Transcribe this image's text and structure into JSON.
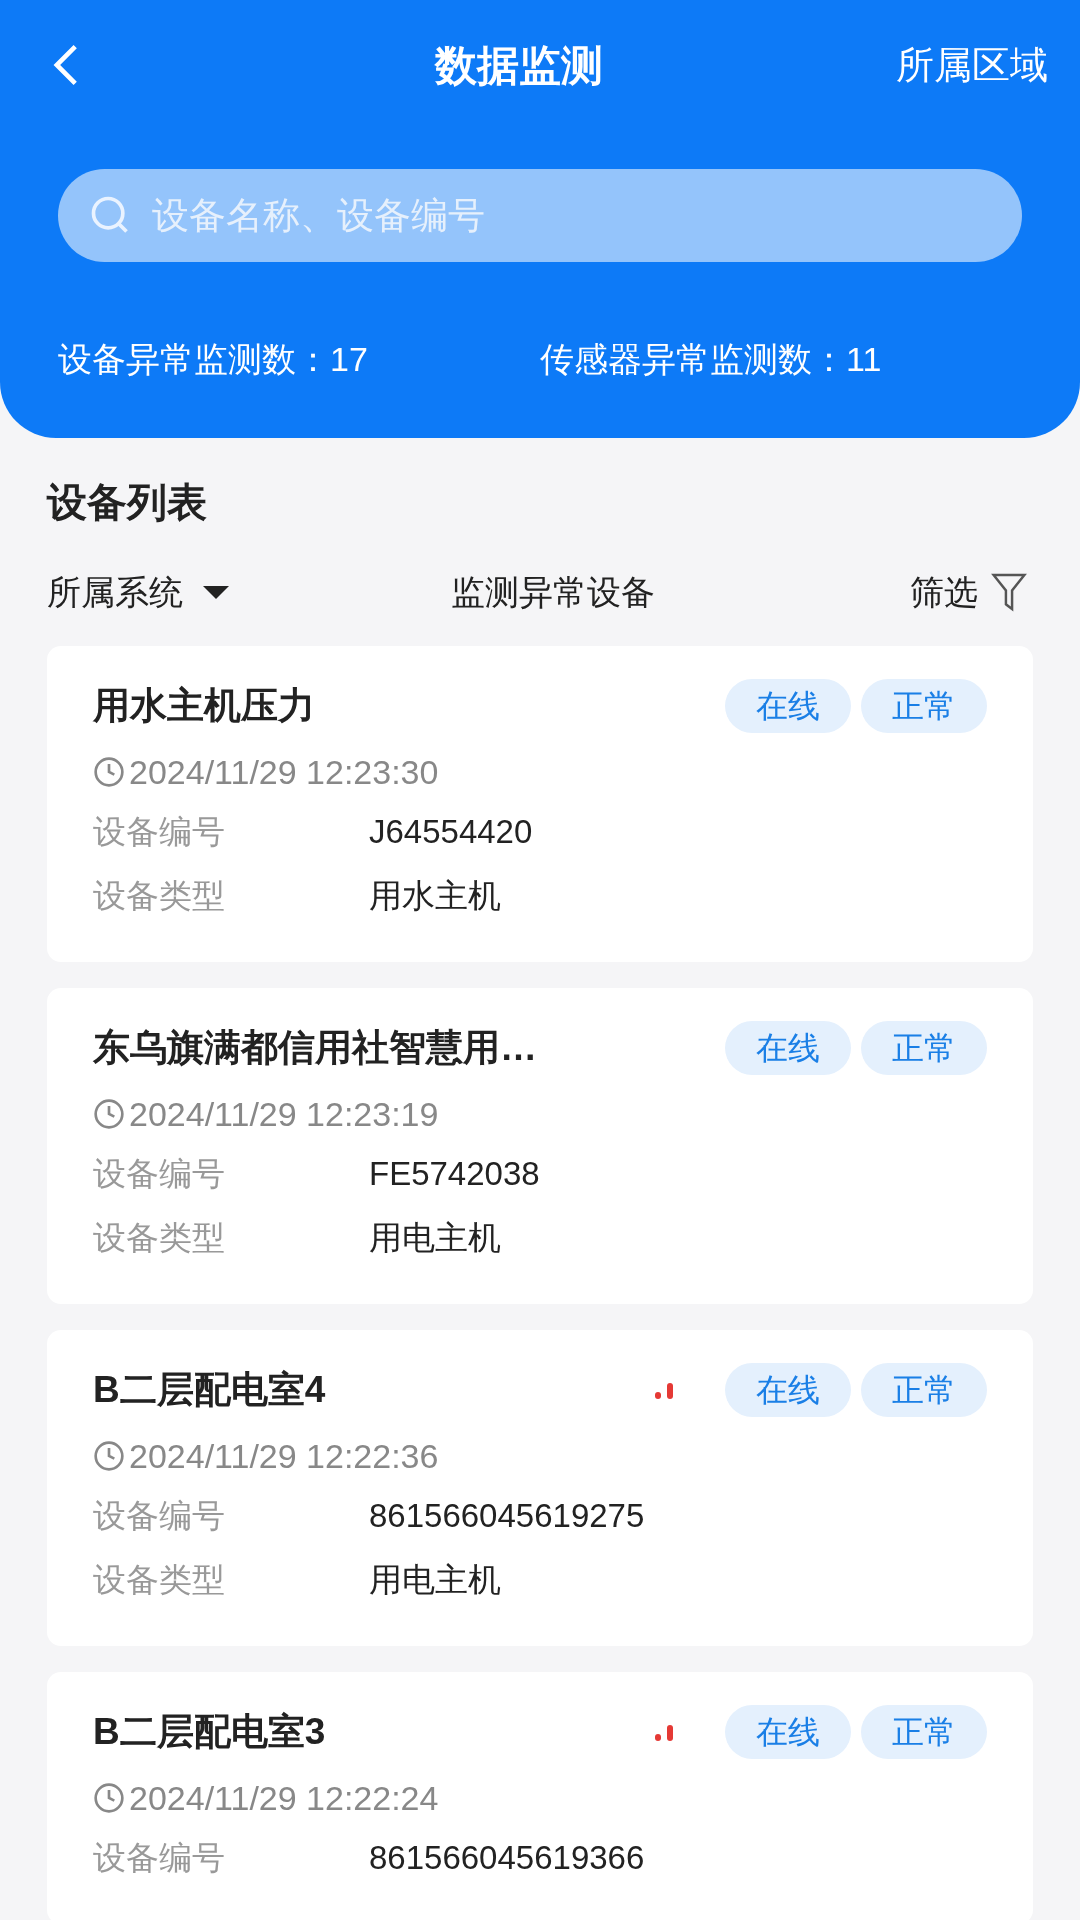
{
  "header": {
    "title": "数据监测",
    "right_action": "所属区域"
  },
  "search": {
    "placeholder": "设备名称、设备编号"
  },
  "stats": [
    {
      "label": "设备异常监测数：",
      "value": "17"
    },
    {
      "label": "传感器异常监测数：",
      "value": "11"
    }
  ],
  "section_title": "设备列表",
  "filters": {
    "system": "所属系统",
    "abnormal": "监测异常设备",
    "filter": "筛选"
  },
  "devices": [
    {
      "name": "用水主机压力",
      "signal_weak": false,
      "badges": [
        "在线",
        "正常"
      ],
      "time": "2024/11/29 12:23:30",
      "fields": [
        {
          "label": "设备编号",
          "value": "J64554420"
        },
        {
          "label": "设备类型",
          "value": "用水主机"
        }
      ]
    },
    {
      "name": "东乌旗满都信用社智慧用…",
      "signal_weak": false,
      "badges": [
        "在线",
        "正常"
      ],
      "time": "2024/11/29 12:23:19",
      "fields": [
        {
          "label": "设备编号",
          "value": "FE5742038"
        },
        {
          "label": "设备类型",
          "value": "用电主机"
        }
      ]
    },
    {
      "name": "B二层配电室4",
      "signal_weak": true,
      "badges": [
        "在线",
        "正常"
      ],
      "time": "2024/11/29 12:22:36",
      "fields": [
        {
          "label": "设备编号",
          "value": "861566045619275"
        },
        {
          "label": "设备类型",
          "value": "用电主机"
        }
      ]
    },
    {
      "name": "B二层配电室3",
      "signal_weak": true,
      "badges": [
        "在线",
        "正常"
      ],
      "time": "2024/11/29 12:22:24",
      "fields": [
        {
          "label": "设备编号",
          "value": "861566045619366"
        }
      ]
    }
  ]
}
